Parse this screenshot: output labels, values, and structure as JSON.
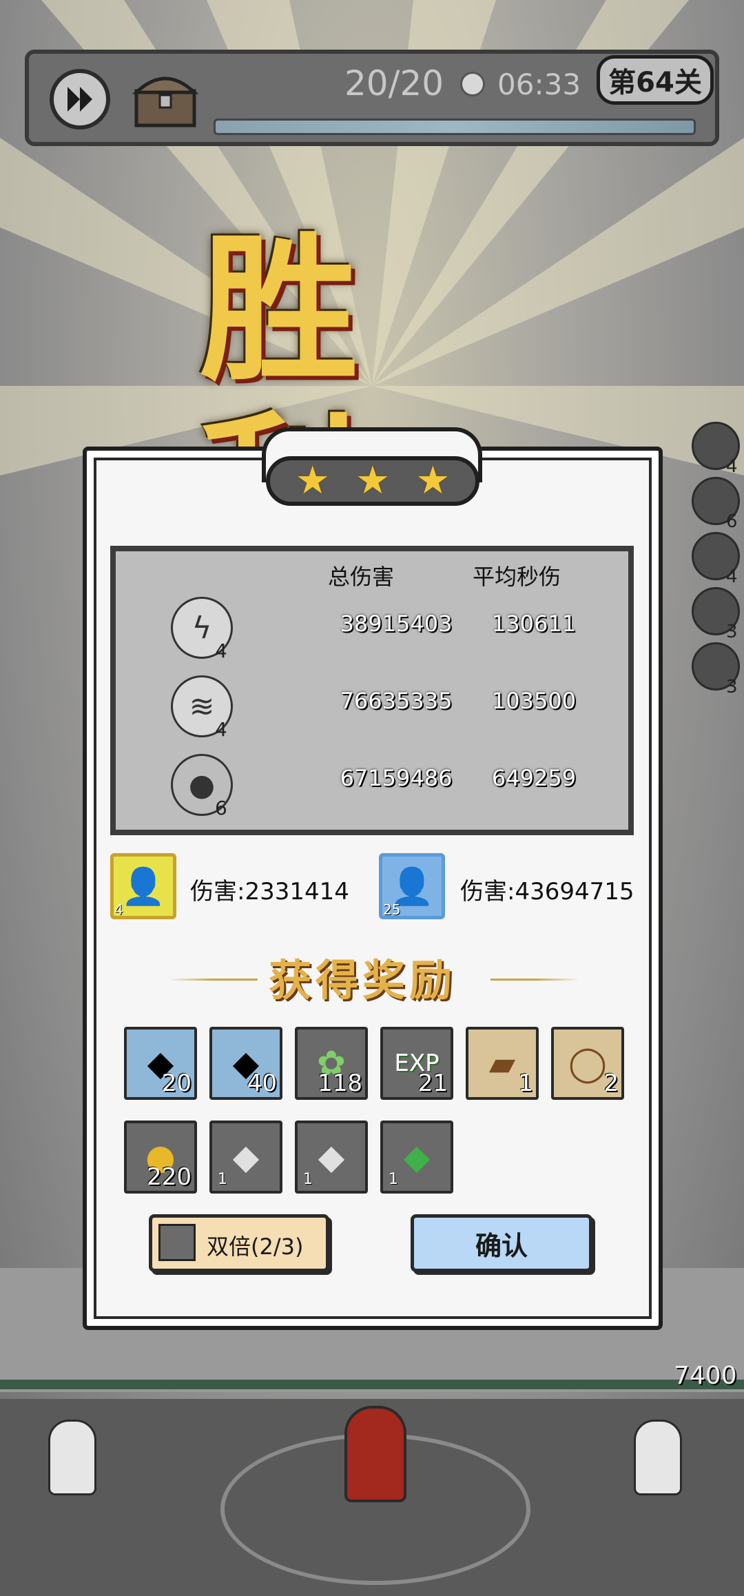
{
  "hud": {
    "wave": "20/20",
    "time": "06:33",
    "level": "第64关"
  },
  "victory_title": "胜利",
  "stars": {
    "earned": 3,
    "total": 3
  },
  "stats": {
    "col_total": "总伤害",
    "col_dps": "平均秒伤",
    "rows": [
      {
        "icon": "lightning-skill-icon",
        "level": "4",
        "total": "38915403",
        "dps": "130611"
      },
      {
        "icon": "tornado-skill-icon",
        "level": "4",
        "total": "76635335",
        "dps": "103500"
      },
      {
        "icon": "bomb-skill-icon",
        "level": "6",
        "total": "67159486",
        "dps": "649259"
      }
    ]
  },
  "heroes": [
    {
      "level": "4",
      "damage": "伤害:2331414",
      "border": "#c9a22b"
    },
    {
      "level": "25",
      "damage": "伤害:43694715",
      "border": "#5b9bd8"
    }
  ],
  "reward_title": "获得奖励",
  "rewards": [
    {
      "icon": "blue-rune-icon",
      "count": "20"
    },
    {
      "icon": "blue-rune-icon",
      "count": "40"
    },
    {
      "icon": "herb-icon",
      "count": "118"
    },
    {
      "icon": "exp-icon",
      "label": "EXP",
      "count": "21"
    },
    {
      "icon": "boot-scroll-icon",
      "count": "1"
    },
    {
      "icon": "ring-scroll-icon",
      "count": "2"
    },
    {
      "icon": "gold-coin-icon",
      "count": "220"
    },
    {
      "icon": "ore-icon",
      "count": "1"
    },
    {
      "icon": "ore-icon",
      "count": "1"
    },
    {
      "icon": "green-gem-icon",
      "count": "1"
    }
  ],
  "buttons": {
    "double": "双倍(2/3)",
    "confirm": "确认"
  },
  "side_counts": [
    "4",
    "6",
    "4",
    "3",
    "3"
  ],
  "wall_hp": "7400"
}
